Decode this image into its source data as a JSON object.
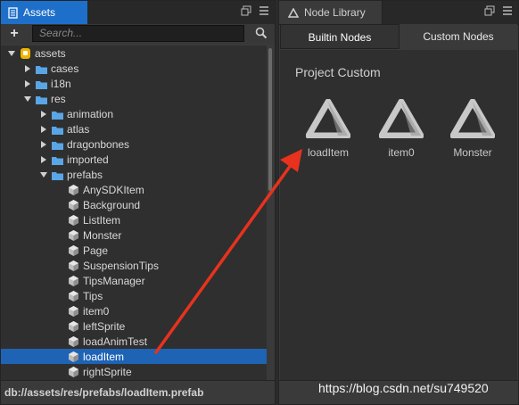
{
  "assets_panel": {
    "title": "Assets",
    "search_placeholder": "Search...",
    "tree": [
      {
        "label": "assets",
        "type": "root",
        "expanded": true
      },
      {
        "label": "cases",
        "type": "folder",
        "expanded": false
      },
      {
        "label": "i18n",
        "type": "folder",
        "expanded": false
      },
      {
        "label": "res",
        "type": "folder",
        "expanded": true
      },
      {
        "label": "animation",
        "type": "folder",
        "expanded": false
      },
      {
        "label": "atlas",
        "type": "folder",
        "expanded": false
      },
      {
        "label": "dragonbones",
        "type": "folder",
        "expanded": false
      },
      {
        "label": "imported",
        "type": "folder",
        "expanded": false
      },
      {
        "label": "prefabs",
        "type": "folder",
        "expanded": true
      },
      {
        "label": "AnySDKItem",
        "type": "prefab"
      },
      {
        "label": "Background",
        "type": "prefab"
      },
      {
        "label": "ListItem",
        "type": "prefab"
      },
      {
        "label": "Monster",
        "type": "prefab"
      },
      {
        "label": "Page",
        "type": "prefab"
      },
      {
        "label": "SuspensionTips",
        "type": "prefab"
      },
      {
        "label": "TipsManager",
        "type": "prefab"
      },
      {
        "label": "Tips",
        "type": "prefab"
      },
      {
        "label": "item0",
        "type": "prefab"
      },
      {
        "label": "leftSprite",
        "type": "prefab"
      },
      {
        "label": "loadAnimTest",
        "type": "prefab"
      },
      {
        "label": "loadItem",
        "type": "prefab",
        "selected": true
      },
      {
        "label": "rightSprite",
        "type": "prefab"
      }
    ],
    "status_path": "db://assets/res/prefabs/loadItem.prefab"
  },
  "node_library": {
    "title": "Node Library",
    "tabs": [
      "Builtin Nodes",
      "Custom Nodes"
    ],
    "active_tab": "Custom Nodes",
    "section_title": "Project Custom",
    "items": [
      {
        "label": "loadItem",
        "icon": "prefab-triangle-icon"
      },
      {
        "label": "item0",
        "icon": "prefab-triangle-icon"
      },
      {
        "label": "Monster",
        "icon": "prefab-triangle-icon"
      }
    ]
  },
  "watermark": "https://blog.csdn.net/su749520",
  "colors": {
    "accent": "#1e6fc9",
    "selection": "#1e63b4",
    "folder": "#5aa5e6",
    "arrow": "#e8321e"
  }
}
